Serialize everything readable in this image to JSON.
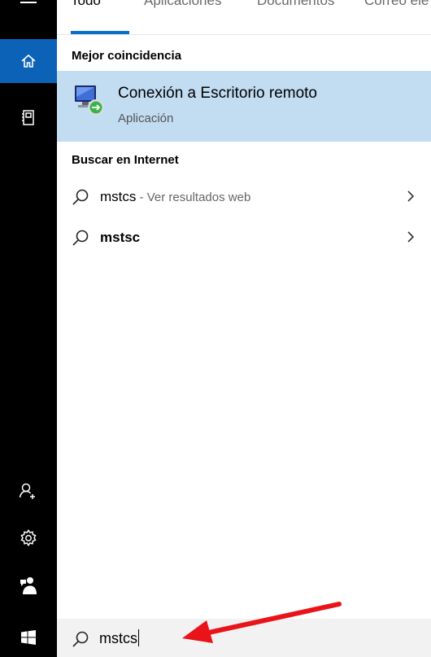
{
  "tabs": [
    "Todo",
    "Aplicaciones",
    "Documentos",
    "Correo ele"
  ],
  "best_match": {
    "heading": "Mejor coincidencia",
    "title": "Conexión a Escritorio remoto",
    "subtitle": "Aplicación"
  },
  "web": {
    "heading": "Buscar en Internet",
    "items": [
      {
        "query": "mstcs",
        "hint": " - Ver resultados web"
      },
      {
        "query": "mstsc",
        "hint": ""
      }
    ]
  },
  "search": {
    "value": "mstcs"
  },
  "sidebar": {
    "icons": [
      "menu-icon",
      "home-icon",
      "notebook-icon",
      "person-add-icon",
      "settings-icon",
      "feedback-icon",
      "windows-start-icon"
    ]
  },
  "colors": {
    "rail": "#000000",
    "rail_active": "#0c62b6",
    "selection": "#c2dcf2",
    "tab_accent": "#0a6fc9",
    "arrow": "#e8141a"
  }
}
